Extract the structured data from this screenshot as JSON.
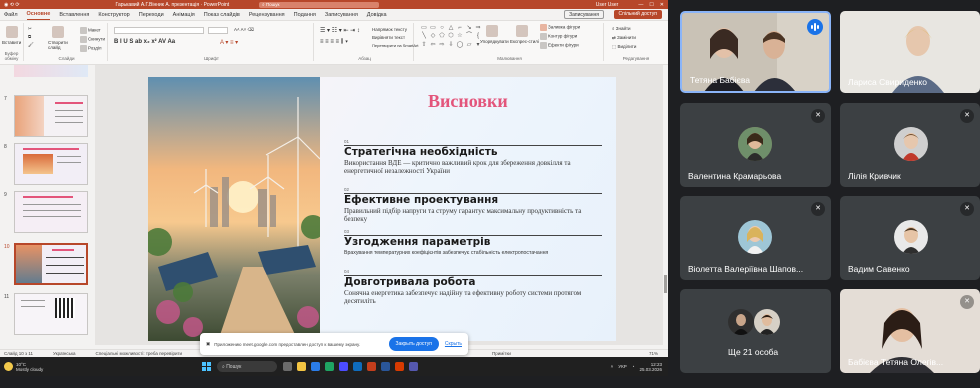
{
  "ppt": {
    "titlebar": {
      "doc_title": "Гарькавий А.Г.Вінник А. презентація · PowerPoint",
      "search": "Пошук",
      "user": "User User"
    },
    "tabs": [
      "Файл",
      "Основне",
      "Вставлення",
      "Конструктор",
      "Переходи",
      "Анімація",
      "Показ слайдів",
      "Рецензування",
      "Подання",
      "Записування",
      "Довідка"
    ],
    "active_tab": "Основне",
    "record_label": "Записування",
    "share_label": "Спільний доступ",
    "ribbon": {
      "groups": [
        "Буфер обміну",
        "Слайди",
        "Шрифт",
        "Абзац",
        "Малювання",
        "Редагування"
      ],
      "paste": "Вставити",
      "new_slide": "Створити слайд",
      "layout": "Макет",
      "reset": "Скинути",
      "section": "Розділ",
      "arrange": "Упорядкувати",
      "quick_styles": "Експрес-стилі",
      "shape_fill": "Заливка фігури",
      "shape_outline": "Контур фігури",
      "shape_effects": "Ефекти фігури",
      "find": "Знайти",
      "replace": "Замінити",
      "select": "Виділити",
      "text_direction": "Напрямок тексту",
      "align_text": "Вирівняти текст",
      "smartart": "Перетворити на SmartArt"
    },
    "thumbnails": [
      {
        "num": "7"
      },
      {
        "num": "8"
      },
      {
        "num": "9"
      },
      {
        "num": "10",
        "selected": true
      },
      {
        "num": "11"
      }
    ],
    "slide": {
      "title": "Висновки",
      "items": [
        {
          "num": "01",
          "head": "Стратегічна необхідність",
          "desc": "Використання ВДЕ — критично важливий крок для збереження довкілля та енергетичної незалежності України"
        },
        {
          "num": "02",
          "head": "Ефективне проектування",
          "desc": "Правильний підбір напруги та струму гарантує максимальну продуктивність та безпеку"
        },
        {
          "num": "03",
          "head": "Узгодження параметрів",
          "desc": "Врахування температурних коефіцієнтів забезпечує стабільність електропостачання"
        },
        {
          "num": "04",
          "head": "Довготривала робота",
          "desc": "Сонячна енергетика забезпечує надійну та ефективну роботу системи протягом десятиліть"
        }
      ]
    },
    "notice": {
      "text": "Приложению meet.google.com предоставлен доступ к вашему экрану.",
      "allow": "Закрыть доступ",
      "hide": "Скрыть"
    },
    "status": {
      "slide": "Слайд 10 з 11",
      "lang": "Українська",
      "access": "Спеціальні можливості: треба перевірити",
      "notes": "Примітки",
      "zoom": "71%"
    },
    "taskbar": {
      "temp": "10°C",
      "weather": "Mostly cloudy",
      "search": "Пошук",
      "lang": "УКР",
      "time": "12:23",
      "date": "25.03.2026"
    }
  },
  "meet": {
    "tiles": [
      {
        "name": "Тетяна Бабієва",
        "speaking": true
      },
      {
        "name": "Лариса Свириденко"
      },
      {
        "name": "Валентина Крамарьова",
        "muted": true
      },
      {
        "name": "Лілія Кривчик",
        "muted": true
      },
      {
        "name": "Віолетта Валеріївна Шапов...",
        "muted": true
      },
      {
        "name": "Вадим Савенко",
        "muted": true
      },
      {
        "name": "Ще 21 особа"
      },
      {
        "name": "Бабієва Тетяна Олегів...",
        "muted": true
      }
    ]
  }
}
